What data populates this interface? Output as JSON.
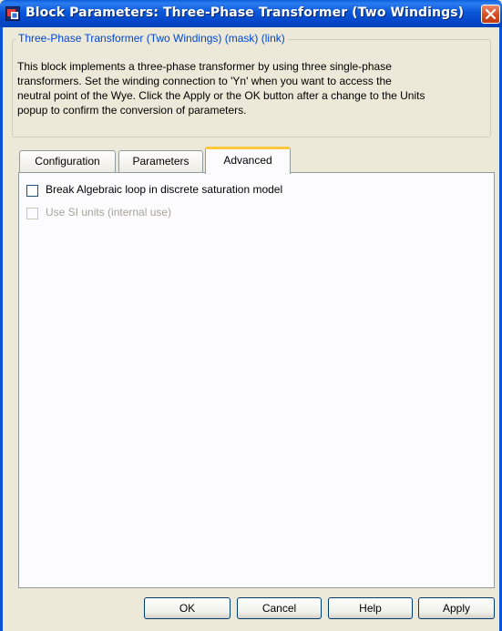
{
  "window": {
    "title": "Block Parameters: Three-Phase Transformer (Two Windings)"
  },
  "icons": {
    "app": "simulink-block-icon",
    "close": "close-icon"
  },
  "mask": {
    "legend": "Three-Phase Transformer (Two Windings) (mask) (link)",
    "description_lines": [
      "This block implements a three-phase transformer by using three single-phase",
      "transformers. Set the winding connection to 'Yn' when you want to access the",
      "neutral point of the Wye. Click the Apply or the OK button after a change to the Units",
      "popup to confirm the conversion of parameters."
    ]
  },
  "tabs": [
    {
      "label": "Configuration",
      "active": false
    },
    {
      "label": "Parameters",
      "active": false
    },
    {
      "label": "Advanced",
      "active": true
    }
  ],
  "advanced": {
    "break_loop": {
      "label": "Break Algebraic loop in discrete saturation model",
      "checked": false,
      "enabled": true
    },
    "si_units": {
      "label": "Use SI units (internal use)",
      "checked": false,
      "enabled": false
    }
  },
  "buttons": {
    "ok": "OK",
    "cancel": "Cancel",
    "help": "Help",
    "apply": "Apply"
  },
  "colors": {
    "titlebar": "#0a56d8",
    "dialog_bg": "#ece9d8",
    "active_tab_accent": "#ffc83c",
    "link_text": "#0046d5",
    "close_button": "#d34c22"
  }
}
